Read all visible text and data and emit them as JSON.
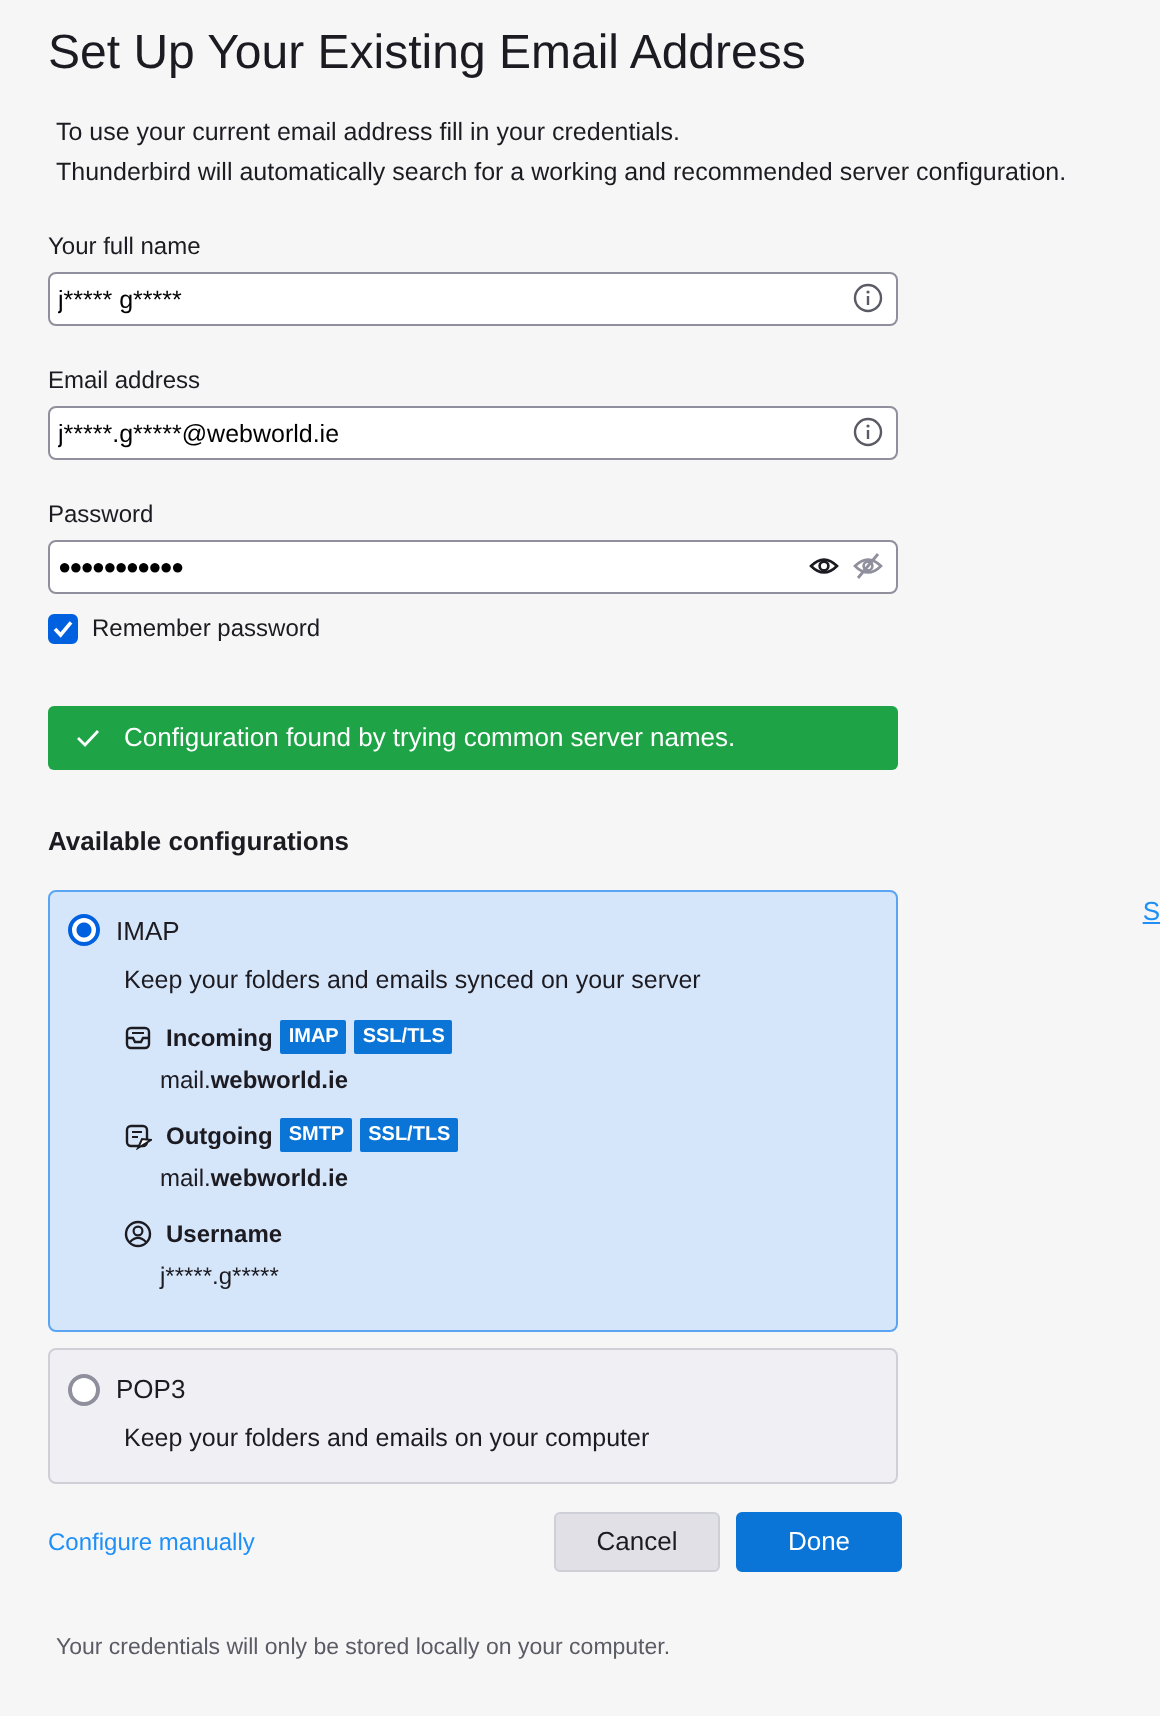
{
  "title": "Set Up Your Existing Email Address",
  "intro": [
    "To use your current email address fill in your credentials.",
    "Thunderbird will automatically search for a working and recommended server configuration."
  ],
  "fields": [
    {
      "label": "Your full name",
      "value": "j***** g*****",
      "kind": "info"
    },
    {
      "label": "Email address",
      "value": "j*****.g*****@webworld.ie",
      "kind": "info"
    },
    {
      "label": "Password",
      "value": "●●●●●●●●●●●",
      "kind": "password"
    }
  ],
  "remember": {
    "label": "Remember password",
    "checked": true
  },
  "status": {
    "text": "Configuration found by trying common server names.",
    "kind": "success"
  },
  "configs_heading": "Available configurations",
  "side_link": "S",
  "configs": [
    {
      "name": "IMAP",
      "description": "Keep your folders and emails synced on your server",
      "selected": true,
      "details": [
        {
          "kind": "incoming",
          "label": "Incoming",
          "tags": [
            "IMAP",
            "SSL/TLS"
          ],
          "value": "mail.",
          "value_bold": "webworld.ie"
        },
        {
          "kind": "outgoing",
          "label": "Outgoing",
          "tags": [
            "SMTP",
            "SSL/TLS"
          ],
          "value": "mail.",
          "value_bold": "webworld.ie"
        },
        {
          "kind": "user",
          "label": "Username",
          "value": "j*****.g*****"
        }
      ]
    },
    {
      "name": "POP3",
      "description": "Keep your folders and emails on your computer",
      "selected": false
    }
  ],
  "manual_link": "Configure manually",
  "buttons": [
    {
      "label": "Cancel",
      "kind": "secondary"
    },
    {
      "label": "Done",
      "kind": "primary"
    }
  ],
  "footer": "Your credentials will only be stored locally on your computer."
}
